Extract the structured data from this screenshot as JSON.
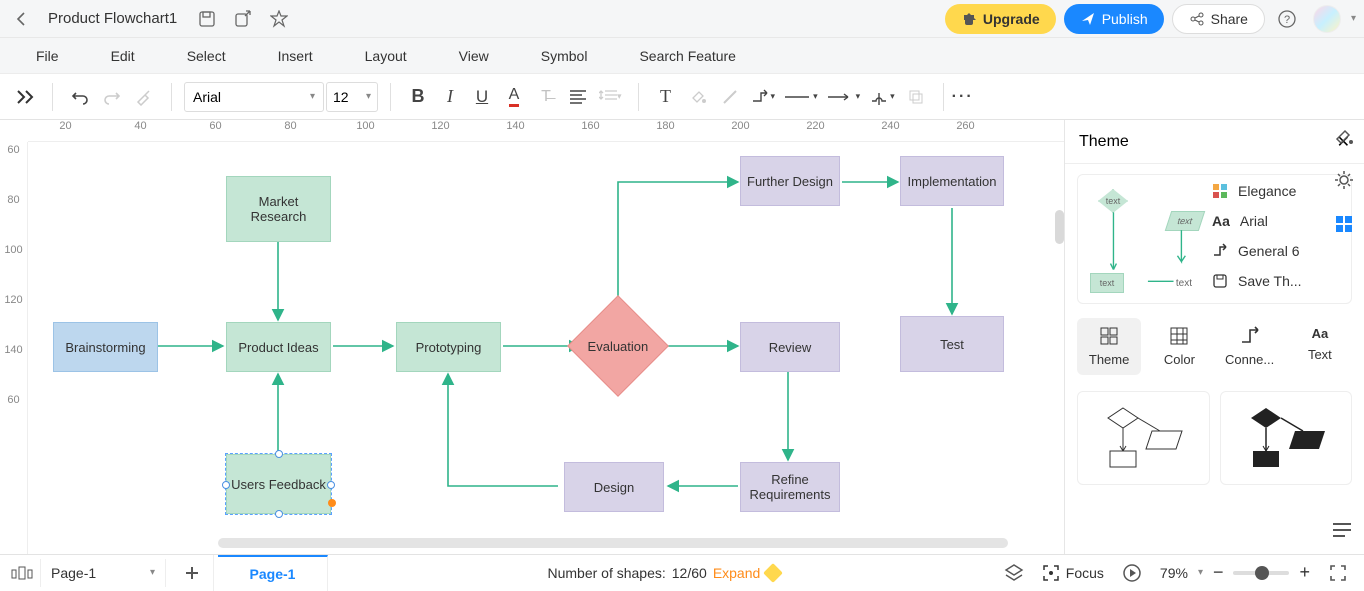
{
  "header": {
    "doc_title": "Product Flowchart1",
    "upgrade": "Upgrade",
    "publish": "Publish",
    "share": "Share"
  },
  "menu": {
    "file": "File",
    "edit": "Edit",
    "select": "Select",
    "insert": "Insert",
    "layout": "Layout",
    "view": "View",
    "symbol": "Symbol",
    "search": "Search Feature"
  },
  "toolbar": {
    "font": "Arial",
    "size": "12"
  },
  "ruler_h": [
    "20",
    "40",
    "60",
    "80",
    "100",
    "120",
    "140",
    "160",
    "180",
    "200",
    "220",
    "240",
    "260"
  ],
  "ruler_v": [
    "60",
    "80",
    "100",
    "120",
    "140",
    "60"
  ],
  "nodes": {
    "brainstorming": "Brainstorming",
    "market_research": "Market Research",
    "product_ideas": "Product Ideas",
    "users_feedback": "Users Feedback",
    "prototyping": "Prototyping",
    "evaluation": "Evaluation",
    "further_design": "Further Design",
    "review": "Review",
    "refine_requirements": "Refine Requirements",
    "design": "Design",
    "implementation": "Implementation",
    "test": "Test"
  },
  "panel": {
    "title": "Theme",
    "elegance": "Elegance",
    "font": "Arial",
    "connector": "General 6",
    "save": "Save Th...",
    "tab_theme": "Theme",
    "tab_color": "Color",
    "tab_conn": "Conne...",
    "tab_text": "Text",
    "preview_text": "text"
  },
  "status": {
    "page_sel": "Page-1",
    "page_tab": "Page-1",
    "shapes_label": "Number of shapes: ",
    "shapes_value": "12/60",
    "expand": "Expand",
    "focus": "Focus",
    "zoom": "79%"
  }
}
